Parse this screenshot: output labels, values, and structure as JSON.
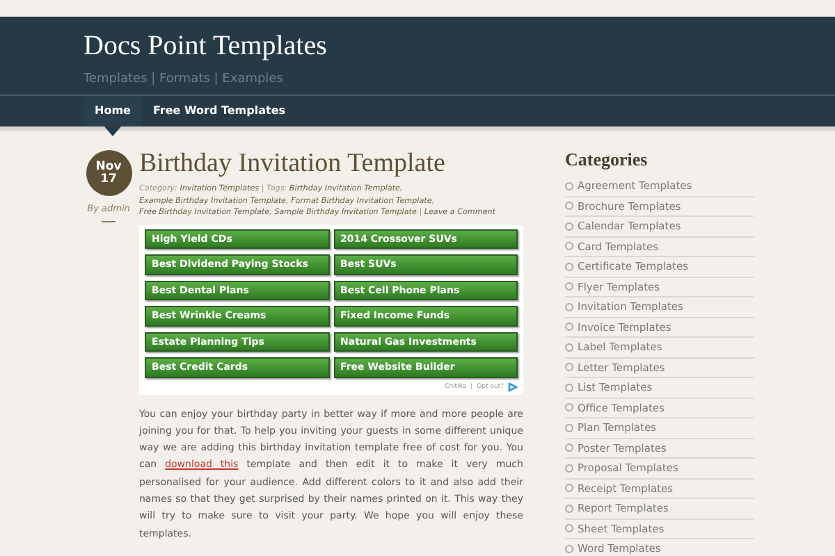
{
  "site": {
    "title": "Docs Point Templates",
    "tagline": "Templates | Formats | Examples"
  },
  "nav": [
    {
      "label": "Home",
      "selected": true
    },
    {
      "label": "Free Word Templates",
      "selected": false
    }
  ],
  "post": {
    "date_month": "Nov",
    "date_day": "17",
    "author": "By admin",
    "title": "Birthday Invitation Template",
    "meta": [
      {
        "kind": "text",
        "text": "Category: "
      },
      {
        "kind": "link",
        "text": "Invitation Templates"
      },
      {
        "kind": "text",
        "text": " | Tags: "
      },
      {
        "kind": "link",
        "text": "Birthday Invitation Template"
      },
      {
        "kind": "text",
        "text": ", "
      },
      {
        "kind": "link",
        "text": "Example Birthday Invitation Template"
      },
      {
        "kind": "text",
        "text": ", "
      },
      {
        "kind": "link",
        "text": "Format Birthday Invitation Template"
      },
      {
        "kind": "text",
        "text": ", "
      },
      {
        "kind": "link",
        "text": "Free Birthday Invitation Template"
      },
      {
        "kind": "text",
        "text": ", "
      },
      {
        "kind": "link",
        "text": "Sample Birthday Invitation Template"
      },
      {
        "kind": "text",
        "text": " | "
      },
      {
        "kind": "link",
        "text": "Leave a Comment"
      }
    ],
    "ads": [
      "High Yield CDs",
      "2014 Crossover SUVs",
      "Best Dividend Paying Stocks",
      "Best SUVs",
      "Best Dental Plans",
      "Best Cell Phone Plans",
      "Best Wrinkle Creams",
      "Fixed Income Funds",
      "Estate Planning Tips",
      "Natural Gas Investments",
      "Best Credit Cards",
      "Free Website Builder"
    ],
    "ad_footer": {
      "brand": "Chitika",
      "separator": "|",
      "optout": "Opt out?"
    },
    "body": [
      {
        "kind": "text",
        "text": "You can enjoy your birthday party in better way if more and more people are joining you for that. To help you inviting your guests in some different unique way we are adding this birthday invitation template free of cost for you. You can "
      },
      {
        "kind": "link",
        "text": "download this"
      },
      {
        "kind": "text",
        "text": " template and then edit it to make it very much personalised for your audience. Add different colors to it and also add their names so that they get surprised by their names printed on it. This way they will try to make sure to visit your party. We hope you will enjoy these templates."
      }
    ]
  },
  "sidebar": {
    "heading": "Categories",
    "items": [
      "Agreement Templates",
      "Brochure Templates",
      "Calendar Templates",
      "Card Templates",
      "Certificate Templates",
      "Flyer Templates",
      "Invitation Templates",
      "Invoice Templates",
      "Label Templates",
      "Letter Templates",
      "List Templates",
      "Office Templates",
      "Plan Templates",
      "Poster Templates",
      "Proposal Templates",
      "Receipt Templates",
      "Report Templates",
      "Sheet Templates",
      "Word Templates"
    ]
  }
}
